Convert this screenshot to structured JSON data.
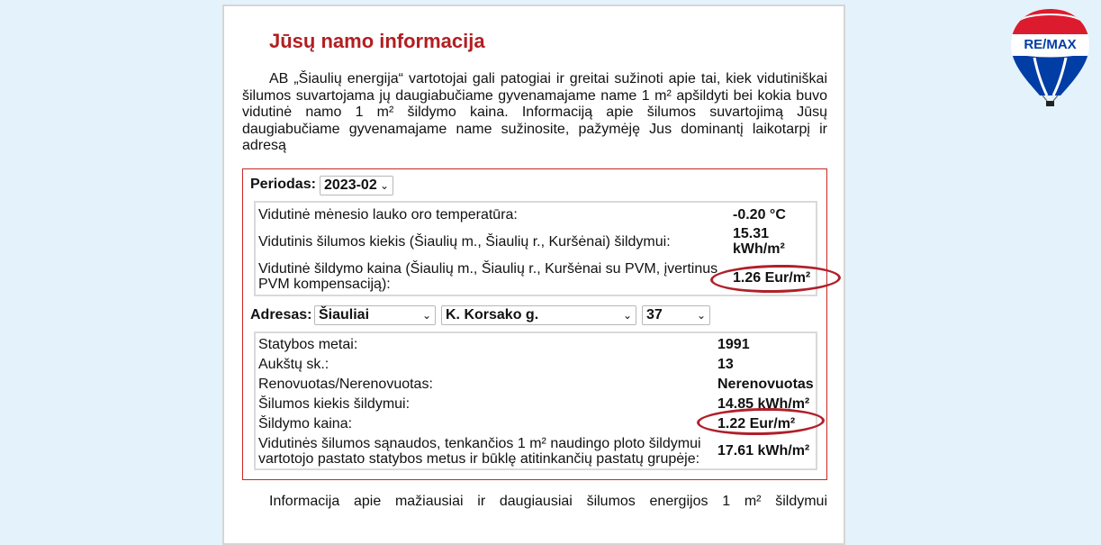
{
  "page": {
    "title": "Jūsų namo informacija",
    "intro": "AB „Šiaulių energija“ vartotojai gali patogiai ir greitai sužinoti apie tai, kiek vidutiniškai šilumos suvartojama jų daugiabučiame gyvenamajame name 1 m² apšildyti bei kokia buvo vidutinė namo 1 m² šildymo kaina. Informaciją apie šilumos suvartojimą Jūsų daugiabučiame gyvenamajame name sužinosite, pažymėję Jus dominantį laikotarpį ir adresą",
    "bottom_text": "Informacija apie mažiausiai ir daugiausiai šilumos energijos 1 m² šildymui"
  },
  "period": {
    "label": "Periodas:",
    "selected": "2023-02",
    "rows": [
      {
        "label": "Vidutinė mėnesio lauko oro temperatūra:",
        "value": "-0.20 °C"
      },
      {
        "label": "Vidutinis šilumos kiekis (Šiaulių m., Šiaulių r., Kuršėnai) šildymui:",
        "value": "15.31 kWh/m²"
      },
      {
        "label": "Vidutinė šildymo kaina (Šiaulių m., Šiaulių r., Kuršėnai su PVM, įvertinus PVM kompensaciją):",
        "value": "1.26 Eur/m²"
      }
    ]
  },
  "address": {
    "label": "Adresas:",
    "city": "Šiauliai",
    "street": "K. Korsako g.",
    "number": "37",
    "rows": [
      {
        "label": "Statybos metai:",
        "value": "1991"
      },
      {
        "label": "Aukštų sk.:",
        "value": "13"
      },
      {
        "label": "Renovuotas/Nerenovuotas:",
        "value": "Nerenovuotas"
      },
      {
        "label": "Šilumos kiekis šildymui:",
        "value": "14.85 kWh/m²"
      },
      {
        "label": "Šildymo kaina:",
        "value": "1.22 Eur/m²"
      },
      {
        "label": "Vidutinės šilumos sąnaudos, tenkančios 1 m² naudingo ploto šildymui vartotojo pastato statybos metus ir būklę atitinkančių pastatų grupėje:",
        "value": "17.61 kWh/m²"
      }
    ]
  },
  "logo": {
    "text": "RE/MAX",
    "icon": "hot-air-balloon-icon"
  },
  "colors": {
    "background": "#e3f2fb",
    "title": "#b21e22",
    "box_border": "#c62828",
    "highlight_oval": "#b0202a",
    "remax_red": "#dc1c2e",
    "remax_blue": "#003da5"
  }
}
